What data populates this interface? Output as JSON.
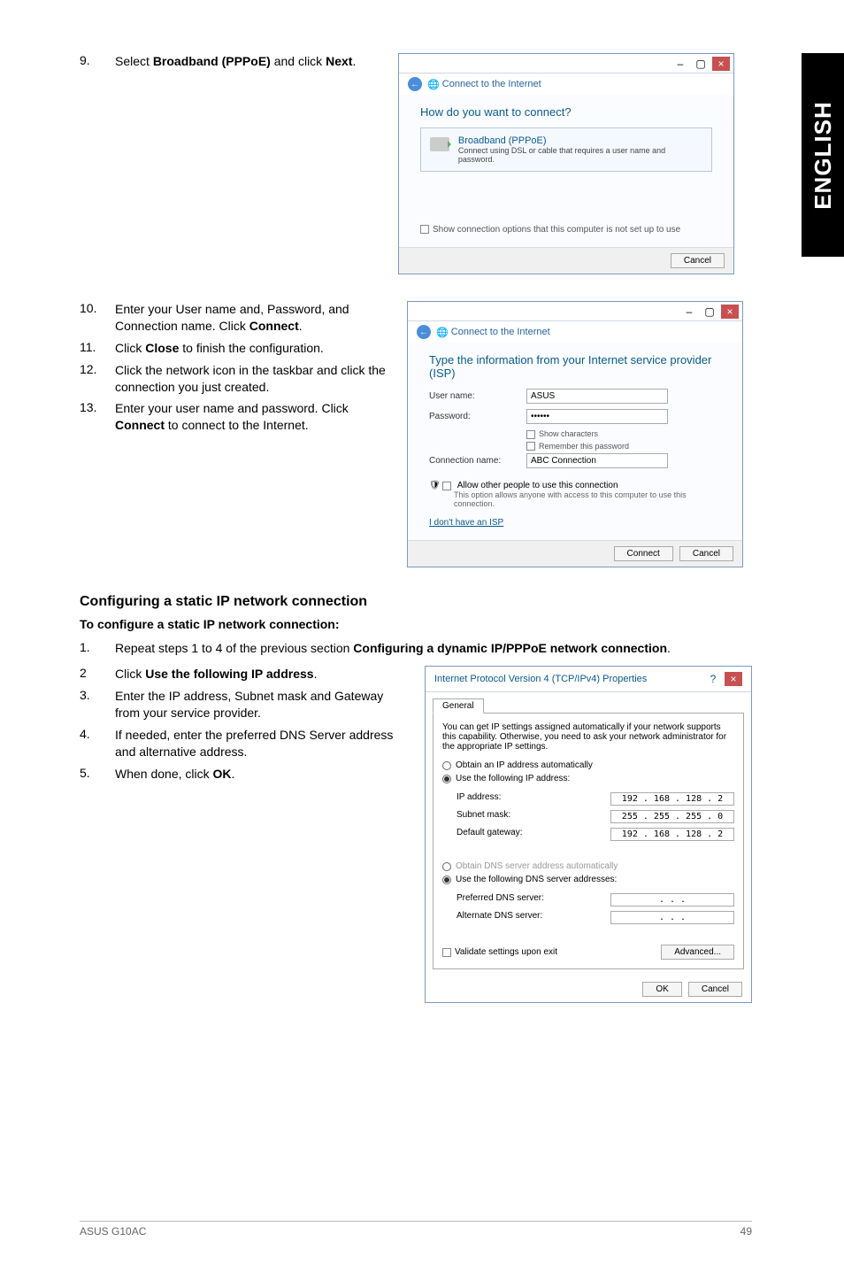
{
  "side_tab": "ENGLISH",
  "steps": {
    "s9": {
      "num": "9.",
      "prefix": "Select ",
      "bold": "Broadband (PPPoE)",
      "mid": " and click ",
      "bold2": "Next",
      "suffix": "."
    },
    "s10": {
      "num": "10.",
      "text_a": "Enter your User name and, Password, and Connection name. Click ",
      "bold": "Connect",
      "text_b": "."
    },
    "s11": {
      "num": "11.",
      "text_a": "Click ",
      "bold": "Close",
      "text_b": " to finish the configuration."
    },
    "s12": {
      "num": "12.",
      "text": "Click the network icon in the taskbar and click the connection you just created."
    },
    "s13": {
      "num": "13.",
      "text_a": "Enter your user name and password. Click ",
      "bold": "Connect",
      "text_b": " to connect to the Internet."
    }
  },
  "static_section": {
    "heading": "Configuring a static IP network connection",
    "subheading": "To configure a static IP network connection:",
    "s1": {
      "num": "1.",
      "text_a": "Repeat steps 1 to 4 of the previous section ",
      "bold": "Configuring a dynamic IP/PPPoE network connection",
      "text_b": "."
    },
    "s2": {
      "num": "2",
      "text_a": "Click ",
      "bold": "Use the following IP address",
      "text_b": "."
    },
    "s3": {
      "num": "3.",
      "text": "Enter the IP address, Subnet mask and Gateway from your service provider."
    },
    "s4": {
      "num": "4.",
      "text": "If needed, enter the preferred DNS Server address and alternative address."
    },
    "s5": {
      "num": "5.",
      "text_a": "When done, click ",
      "bold": "OK",
      "text_b": "."
    }
  },
  "dialog1": {
    "back_label": "Connect to the Internet",
    "heading": "How do you want to connect?",
    "opt_title": "Broadband (PPPoE)",
    "opt_desc": "Connect using DSL or cable that requires a user name and password.",
    "show_opts": "Show connection options that this computer is not set up to use",
    "cancel": "Cancel"
  },
  "dialog2": {
    "back_label": "Connect to the Internet",
    "heading": "Type the information from your Internet service provider (ISP)",
    "lbl_user": "User name:",
    "val_user": "ASUS",
    "lbl_pass": "Password:",
    "val_pass": "••••••",
    "chk_show": "Show characters",
    "chk_remember": "Remember this password",
    "lbl_conn": "Connection name:",
    "val_conn": "ABC Connection",
    "allow_label": "Allow other people to use this connection",
    "allow_desc": "This option allows anyone with access to this computer to use this connection.",
    "no_isp": "I don't have an ISP",
    "connect": "Connect",
    "cancel": "Cancel"
  },
  "ipv4": {
    "title": "Internet Protocol Version 4 (TCP/IPv4) Properties",
    "tab": "General",
    "desc": "You can get IP settings assigned automatically if your network supports this capability. Otherwise, you need to ask your network administrator for the appropriate IP settings.",
    "r_obtain": "Obtain an IP address automatically",
    "r_use": "Use the following IP address:",
    "lbl_ip": "IP address:",
    "val_ip": "192 . 168 . 128 .  2",
    "lbl_mask": "Subnet mask:",
    "val_mask": "255 . 255 . 255 .  0",
    "lbl_gw": "Default gateway:",
    "val_gw": "192 . 168 . 128 .  2",
    "r_dns_auto": "Obtain DNS server address automatically",
    "r_dns_use": "Use the following DNS server addresses:",
    "lbl_pref": "Preferred DNS server:",
    "val_pref": ".       .       .",
    "lbl_alt": "Alternate DNS server:",
    "val_alt": ".       .       .",
    "validate": "Validate settings upon exit",
    "advanced": "Advanced...",
    "ok": "OK",
    "cancel": "Cancel"
  },
  "footer": {
    "left": "ASUS G10AC",
    "right": "49"
  }
}
